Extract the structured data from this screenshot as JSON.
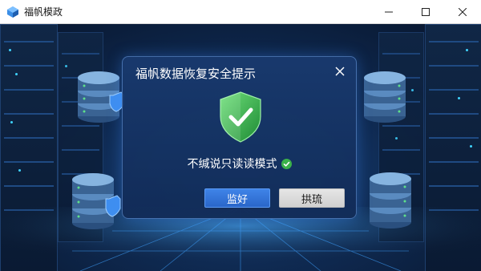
{
  "window": {
    "title": "福帆模政",
    "controls": {
      "minimize": "minimize-icon",
      "maximize": "maximize-icon",
      "close": "close-icon"
    }
  },
  "dialog": {
    "title": "福帆数据恢复安全提示",
    "status_text": "不缄说只读读模式",
    "status_icon": "check-circle-icon",
    "shield_icon": "shield-check-icon",
    "primary_button": "监好",
    "secondary_button": "拱琉"
  },
  "colors": {
    "accent": "#2f73d8",
    "shield_green": "#3bb24a",
    "dialog_bg": "#193a6e"
  }
}
